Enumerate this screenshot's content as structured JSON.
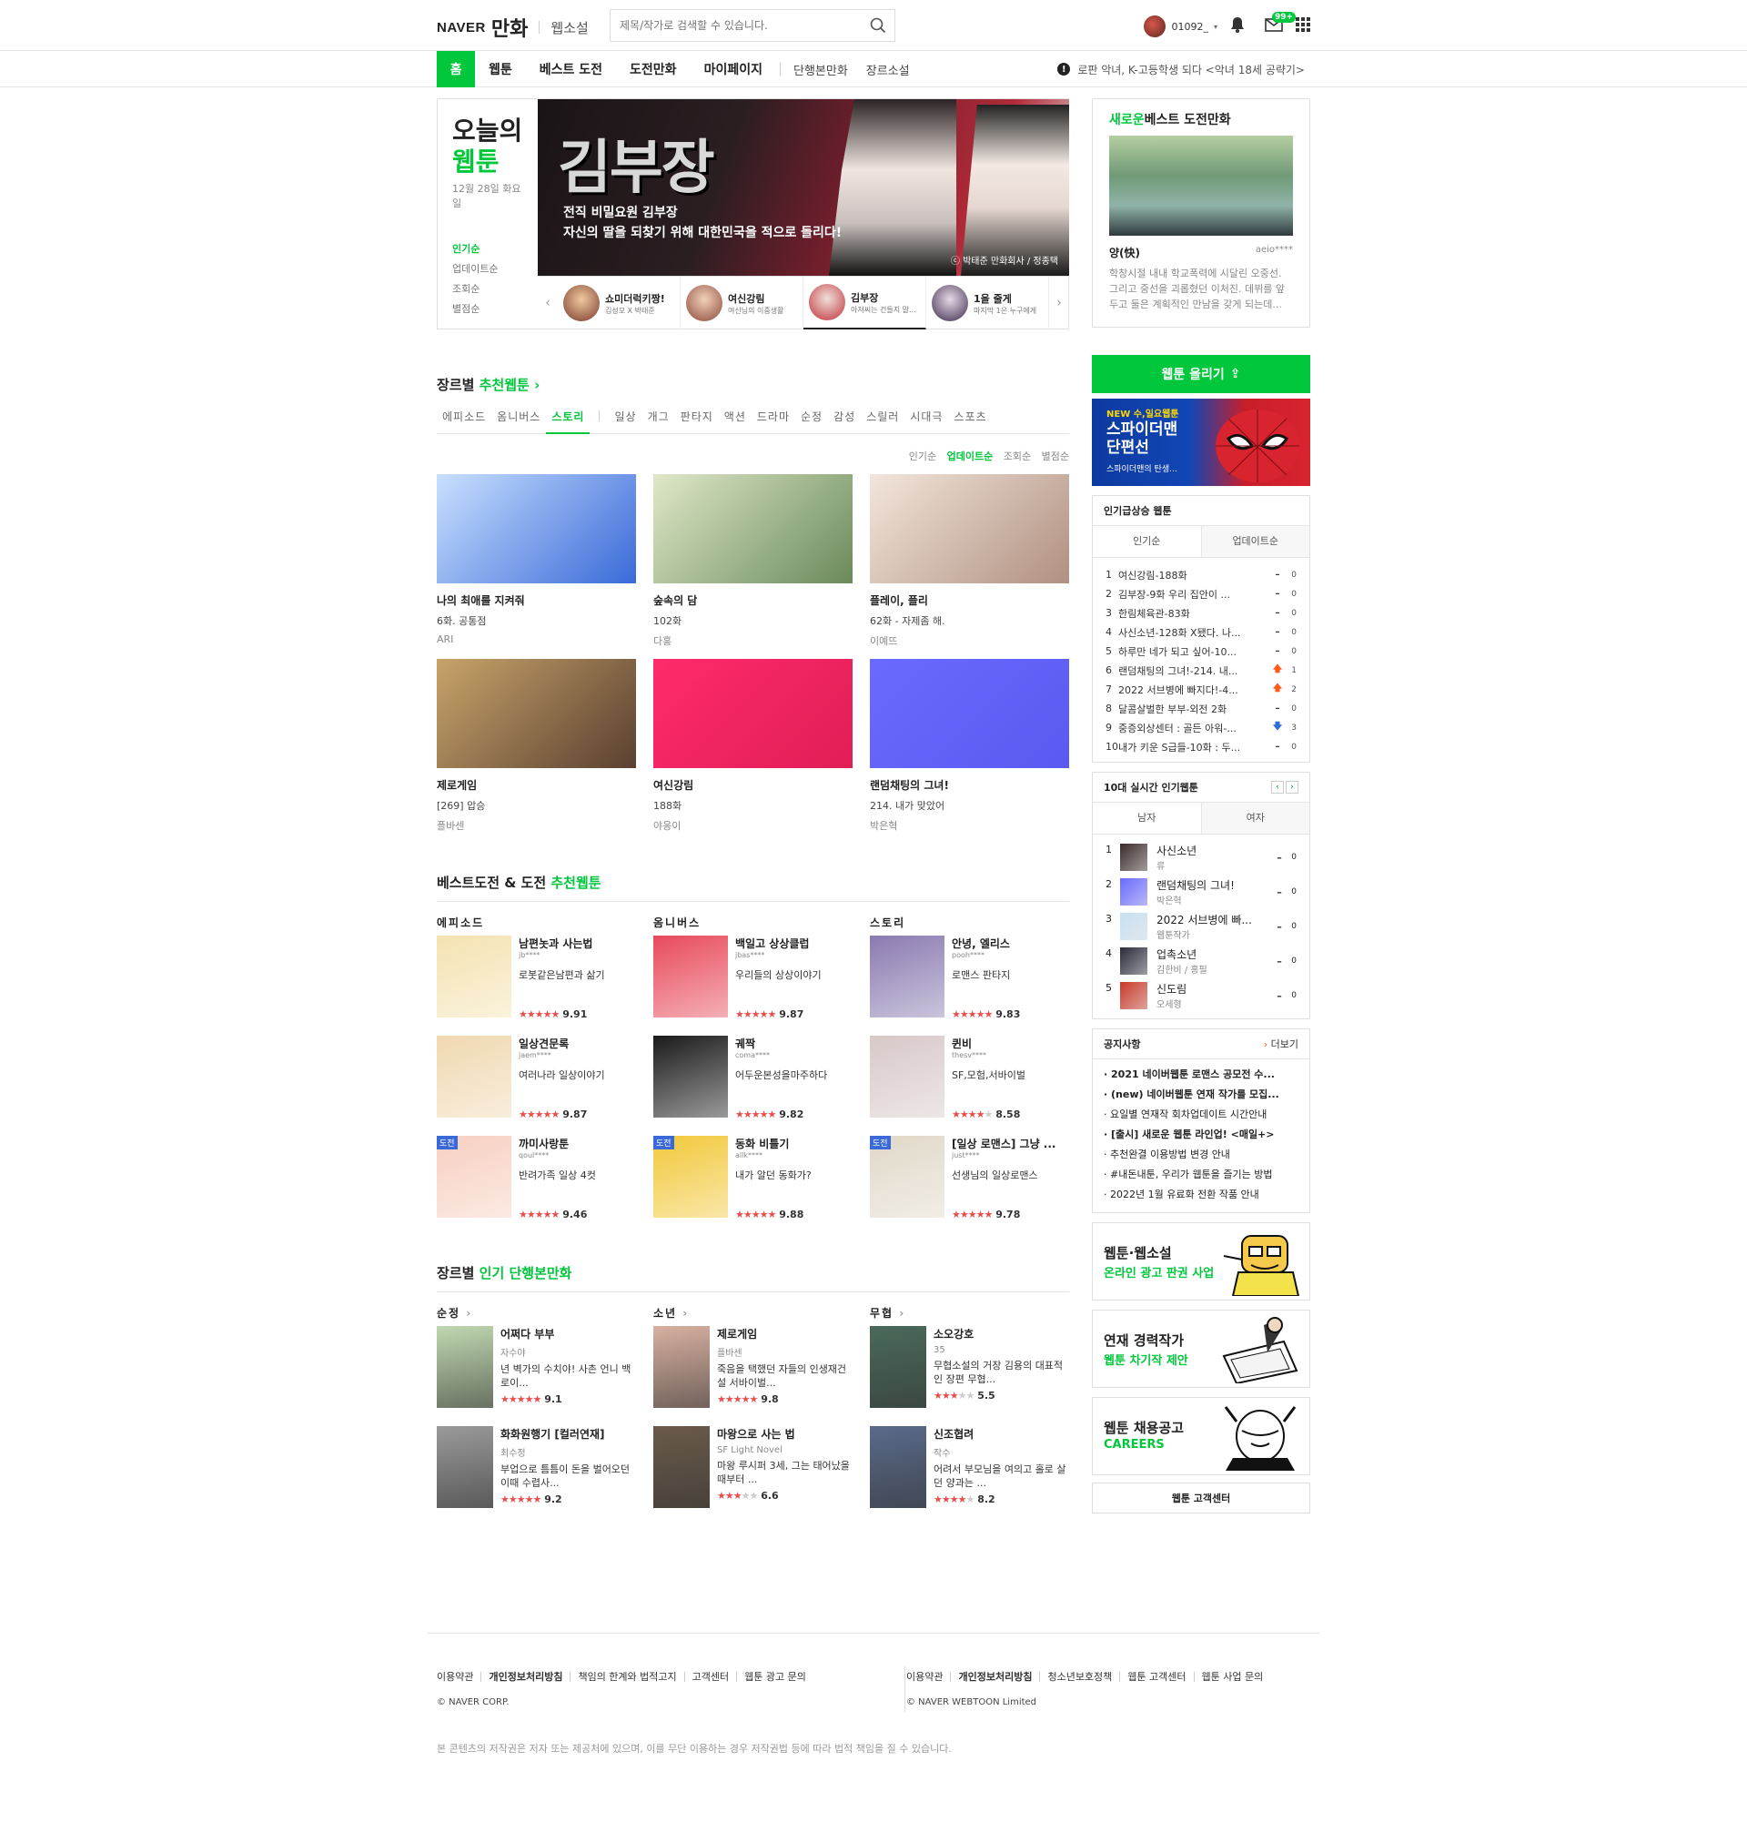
{
  "header": {
    "logo_naver": "NAVER",
    "logo_main": "만화",
    "logo_sub": "웹소설",
    "search_placeholder": "제목/작가로 검색할 수 있습니다.",
    "username": "01092_",
    "mail_badge": "99+"
  },
  "nav": {
    "items": [
      "홈",
      "웹툰",
      "베스트 도전",
      "도전만화",
      "마이페이지"
    ],
    "sub_items": [
      "단행본만화",
      "장르소설"
    ],
    "ticker": "로판 악녀, K-고등학생 되다 <악녀 18세 공략기>"
  },
  "today": {
    "title1": "오늘의",
    "title2": "웹툰",
    "date": "12월 28일 화요일",
    "sorts": [
      "인기순",
      "업데이트순",
      "조회순",
      "별점순"
    ],
    "banner_title": "김부장",
    "banner_line1": "전직 비밀요원 김부장",
    "banner_line2": "자신의 딸을 되찾기 위해 대한민국을 적으로 돌리다!",
    "banner_credit": "ⓒ 박태준 만화회사 / 정종택",
    "thumbs": [
      {
        "title": "쇼미더럭키짱!",
        "sub": "김성모 X 박태준",
        "color": "#7a3a2a"
      },
      {
        "title": "여신강림",
        "sub": "여신님의 이중생활",
        "color": "#8a4a3a"
      },
      {
        "title": "김부장",
        "sub": "아저씨는 건들지 말...",
        "color": "#c0303a"
      },
      {
        "title": "1을 줄게",
        "sub": "마지막 1은 누구에게",
        "color": "#3a2a4a"
      }
    ]
  },
  "genre_section": {
    "title": "장르별",
    "title_green": "추천웹툰",
    "tabs": [
      "에피소드",
      "옴니버스",
      "스토리"
    ],
    "tabs2": [
      "일상",
      "개그",
      "판타지",
      "액션",
      "드라마",
      "순정",
      "감성",
      "스릴러",
      "시대극",
      "스포츠"
    ],
    "sorts": [
      "인기순",
      "업데이트순",
      "조회순",
      "별점순"
    ],
    "cards": [
      {
        "name": "나의 최애를 지켜줘",
        "ep": "6화. 공통점",
        "author": "ARI",
        "c1": "#c8e0ff",
        "c2": "#3a6ad8"
      },
      {
        "name": "숲속의 담",
        "ep": "102화",
        "author": "다홍",
        "c1": "#dfe8c8",
        "c2": "#6a8a5a"
      },
      {
        "name": "플레이, 플리",
        "ep": "62화 - 자제좀 해.",
        "author": "이예뜨",
        "c1": "#f3e6dc",
        "c2": "#b09080"
      },
      {
        "name": "제로게임",
        "ep": "[269] 압승",
        "author": "플바센",
        "c1": "#c8a46a",
        "c2": "#5a4030"
      },
      {
        "name": "여신강림",
        "ep": "188화",
        "author": "야옹이",
        "c1": "#ff2a6a",
        "c2": "#e01e56"
      },
      {
        "name": "랜덤채팅의 그녀!",
        "ep": "214. 내가 맞았어",
        "author": "박은혁",
        "c1": "#6a6aff",
        "c2": "#5a5af0"
      }
    ]
  },
  "best_section": {
    "title": "베스트도전 & 도전",
    "title_green": "추천웹툰",
    "columns": [
      {
        "name": "에피소드",
        "items": [
          {
            "title": "남편놋과 사는법",
            "user": "jb****",
            "desc": "로봇같은남편과 삶기",
            "stars": 5,
            "score": "9.91",
            "tag": "",
            "color": "#f4e2b0"
          },
          {
            "title": "일상견문록",
            "user": "jaem****",
            "desc": "여러나라 일상이야기",
            "stars": 5,
            "score": "9.87",
            "tag": "",
            "color": "#f0d8b0"
          },
          {
            "title": "까미사랑툰",
            "user": "qoul****",
            "desc": "반려가족 일상 4컷",
            "stars": 5,
            "score": "9.46",
            "tag": "도전",
            "color": "#f7cfc0"
          }
        ]
      },
      {
        "name": "옴니버스",
        "items": [
          {
            "title": "백일고 상상클럽",
            "user": "jbas****",
            "desc": "우리들의 상상이야기",
            "stars": 5,
            "score": "9.87",
            "tag": "",
            "color": "#e84a5a"
          },
          {
            "title": "궤짝",
            "user": "coma****",
            "desc": "어두운본성을마주하다",
            "stars": 5,
            "score": "9.82",
            "tag": "",
            "color": "#1a1a1a"
          },
          {
            "title": "동화 비틀기",
            "user": "allk****",
            "desc": "내가 알던 동화가?",
            "stars": 5,
            "score": "9.88",
            "tag": "도전",
            "color": "#f2c83a"
          }
        ]
      },
      {
        "name": "스토리",
        "items": [
          {
            "title": "안녕, 엘리스",
            "user": "pooh****",
            "desc": "로맨스 판타지",
            "stars": 5,
            "score": "9.83",
            "tag": "",
            "color": "#8a7ab0"
          },
          {
            "title": "퀸비",
            "user": "thesv****",
            "desc": "SF,모험,서바이벌",
            "stars": 4,
            "score": "8.58",
            "tag": "",
            "color": "#d8c8c8"
          },
          {
            "title": "[일상 로맨스] 그냥 ...",
            "user": "just****",
            "desc": "선생님의 일상로맨스",
            "stars": 5,
            "score": "9.78",
            "tag": "도전",
            "color": "#e0d8c8"
          }
        ]
      }
    ]
  },
  "book_section": {
    "title": "장르별",
    "title_green": "인기 단행본만화",
    "columns": [
      {
        "name": "순정",
        "items": [
          {
            "title": "어쩌다 부부",
            "author": "자수야",
            "desc": "년 벽가의 수치야! 사촌 언니 백로이...",
            "stars": 5,
            "score": "9.1",
            "color": "#c0d8b0"
          },
          {
            "title": "화화원행기 [컬러연재]",
            "author": "최수정",
            "desc": "부업으로 틈틈이 돈을 벌어오던 이때 수렵사...",
            "stars": 5,
            "score": "9.2",
            "color": "#9a9a9a"
          }
        ]
      },
      {
        "name": "소년",
        "items": [
          {
            "title": "제로게임",
            "author": "플바센",
            "desc": "죽음을 택했던 자들의 인생재건설 서바이벌...",
            "stars": 5,
            "score": "9.8",
            "color": "#d8b0a0"
          },
          {
            "title": "마왕으로 사는 법",
            "author": "SF Light Novel",
            "desc": "마왕 루시퍼 3세, 그는 태어났을 때부터 ...",
            "stars": 3,
            "score": "6.6",
            "color": "#6a5a4a"
          }
        ]
      },
      {
        "name": "무협",
        "items": [
          {
            "title": "소오강호",
            "author": "35",
            "desc": "무협소설의 거장 김용의 대표적인 장편 무협...",
            "stars": 3,
            "score": "5.5",
            "color": "#4a6a5a"
          },
          {
            "title": "신조협려",
            "author": "작수",
            "desc": "어려서 부모님을 여의고 홀로 살던 양과는 ...",
            "stars": 4,
            "score": "8.2",
            "color": "#5a6a8a"
          }
        ]
      }
    ]
  },
  "side": {
    "bestnew_title_green": "새로운",
    "bestnew_title": "베스트 도전만화",
    "bestnew_name": "양(快)",
    "bestnew_author": "aeio****",
    "bestnew_desc": "학창시절 내내 학교폭력에 시달린 오중선. 그리고 중선을 괴롭혔던 이처진. 데뷔를 앞두고 둘은 계획적인 만남을 갖게 되는데...",
    "upload_label": "웹툰 올리기",
    "ad_small": "NEW 수,일요웹툰",
    "ad_title1": "스파이더맨",
    "ad_title2": "단편선",
    "ad_sub": "스파이더맨의 탄생...",
    "rank_title": "인기급상승 웹툰",
    "rank_tabs": [
      "인기순",
      "업데이트순"
    ],
    "rank": [
      {
        "no": "1",
        "title": "여신강림-188화",
        "dir": "same",
        "val": "0"
      },
      {
        "no": "2",
        "title": "김부장-9화 우리 집안이 ...",
        "dir": "same",
        "val": "0"
      },
      {
        "no": "3",
        "title": "한림체육관-83화",
        "dir": "same",
        "val": "0"
      },
      {
        "no": "4",
        "title": "사신소년-128화 X됐다. 나...",
        "dir": "same",
        "val": "0"
      },
      {
        "no": "5",
        "title": "하루만 네가 되고 싶어-10...",
        "dir": "same",
        "val": "0"
      },
      {
        "no": "6",
        "title": "랜덤채팅의 그녀!-214. 내...",
        "dir": "up",
        "val": "1"
      },
      {
        "no": "7",
        "title": "2022 서브병에 빠지다!-4...",
        "dir": "up",
        "val": "2"
      },
      {
        "no": "8",
        "title": "달콤살벌한 부부-외전 2화",
        "dir": "same",
        "val": "0"
      },
      {
        "no": "9",
        "title": "중증외상센터 : 골든 아워-...",
        "dir": "down",
        "val": "3"
      },
      {
        "no": "10",
        "title": "내가 키운 S급들-10화 : 두...",
        "dir": "same",
        "val": "0"
      }
    ],
    "live_title": "10대 실시간 인기웹툰",
    "live_tabs": [
      "남자",
      "여자"
    ],
    "live": [
      {
        "no": "1",
        "title": "사신소년",
        "author": "류",
        "color": "#3a2a2a"
      },
      {
        "no": "2",
        "title": "랜덤채팅의 그녀!",
        "author": "박은혁",
        "color": "#6a6aff"
      },
      {
        "no": "3",
        "title": "2022 서브병에 빠...",
        "author": "웹툰작가",
        "color": "#c8e0f0"
      },
      {
        "no": "4",
        "title": "업촉소년",
        "author": "김한비 / 홍필",
        "color": "#2a2a3a"
      },
      {
        "no": "5",
        "title": "신도림",
        "author": "오세형",
        "color": "#c83a2a"
      }
    ],
    "notice_title": "공지사항",
    "notice_more": "더보기",
    "notices": [
      {
        "text": "2021 네이버웹툰 로맨스 공모전 수...",
        "bold": true
      },
      {
        "text": "(new) 네이버웹툰 연재 작가를 모집...",
        "bold": true
      },
      {
        "text": "요일별 연재작 회차업데이트 시간안내",
        "bold": false
      },
      {
        "text": "[출시] 새로운 웹툰 라인업! <매일+>",
        "bold": true
      },
      {
        "text": "추천완결 이용방법 변경 안내",
        "bold": false
      },
      {
        "text": "#내돈내툰, 우리가 웹툰을 즐기는 방법",
        "bold": false
      },
      {
        "text": "2022년 1월 유료화 전환 작품 안내",
        "bold": false
      }
    ],
    "ads": [
      {
        "l1": "웹툰·웹소설",
        "l2": "온라인 광고 판권 사업"
      },
      {
        "l1": "연재 경력작가",
        "l2": "웹툰 차기작 제안"
      },
      {
        "l1": "웹툰 채용공고",
        "l2": "CAREERS"
      }
    ],
    "help_label": "웹툰 고객센터"
  },
  "footer": {
    "left_links": [
      "이용약관",
      "개인정보처리방침",
      "책임의 한계와 법적고지",
      "고객센터",
      "웹툰 광고 문의"
    ],
    "right_links": [
      "이용약관",
      "개인정보처리방침",
      "청소년보호정책",
      "웹툰 고객센터",
      "웹툰 사업 문의"
    ],
    "corp_left": "© NAVER CORP.",
    "corp_right": "© NAVER WEBTOON Limited",
    "copyright": "본 콘텐츠의 저작권은 저자 또는 제공처에 있으며, 이를 무단 이용하는 경우 저작권법 등에 따라 법적 책임을 질 수 있습니다."
  },
  "colors": {
    "accent": "#00c73c",
    "star": "#e84e4e",
    "up": "#ff5a1a",
    "down": "#2b6fd8"
  }
}
